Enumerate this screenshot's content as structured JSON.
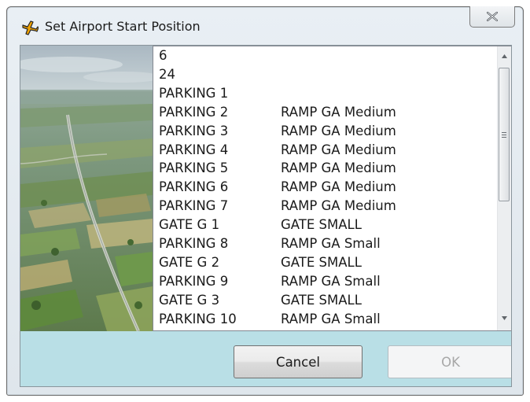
{
  "window": {
    "title": "Set Airport Start Position",
    "app_icon": "airplane-icon",
    "close_icon": "close-icon"
  },
  "positions_list": {
    "items": [
      {
        "name": "6",
        "type": ""
      },
      {
        "name": "24",
        "type": ""
      },
      {
        "name": "PARKING 1",
        "type": ""
      },
      {
        "name": "PARKING 2",
        "type": "RAMP GA Medium"
      },
      {
        "name": "PARKING 3",
        "type": "RAMP GA Medium"
      },
      {
        "name": "PARKING 4",
        "type": "RAMP GA Medium"
      },
      {
        "name": "PARKING 5",
        "type": "RAMP GA Medium"
      },
      {
        "name": "PARKING 6",
        "type": "RAMP GA Medium"
      },
      {
        "name": "PARKING 7",
        "type": "RAMP GA Medium"
      },
      {
        "name": "GATE G 1",
        "type": "GATE SMALL"
      },
      {
        "name": "PARKING 8",
        "type": "RAMP GA Small"
      },
      {
        "name": "GATE G 2",
        "type": "GATE SMALL"
      },
      {
        "name": "PARKING 9",
        "type": "RAMP GA Small"
      },
      {
        "name": "GATE G 3",
        "type": "GATE SMALL"
      },
      {
        "name": "PARKING 10",
        "type": "RAMP GA Small"
      }
    ],
    "scroll": {
      "up_icon": "scroll-up-arrow-icon",
      "down_icon": "scroll-down-arrow-icon"
    }
  },
  "buttons": {
    "cancel": "Cancel",
    "ok": "OK",
    "ok_enabled": false
  },
  "colors": {
    "client_bg": "#b9dfe6",
    "list_bg": "#ffffff",
    "disabled_text": "#a7a7a7"
  }
}
